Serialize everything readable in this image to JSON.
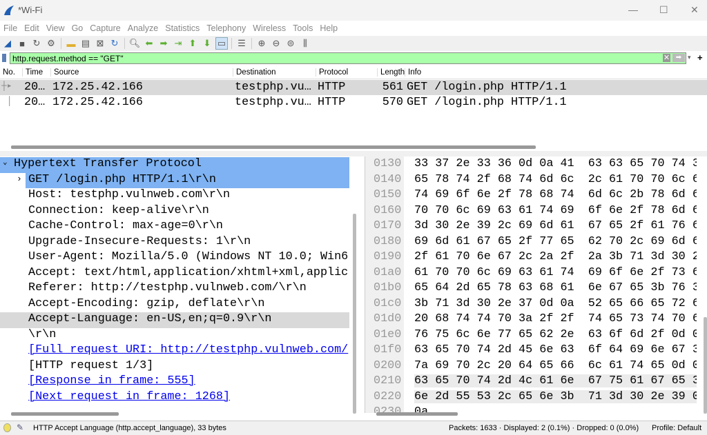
{
  "window": {
    "title": "*Wi-Fi"
  },
  "menu": [
    "File",
    "Edit",
    "View",
    "Go",
    "Capture",
    "Analyze",
    "Statistics",
    "Telephony",
    "Wireless",
    "Tools",
    "Help"
  ],
  "filter": {
    "value": "http.request.method == \"GET\""
  },
  "columns": [
    "No.",
    "Time",
    "Source",
    "Destination",
    "Protocol",
    "Length",
    "Info"
  ],
  "packets": [
    {
      "time": "20…",
      "source": "172.25.42.166",
      "destination": "testphp.vu…",
      "protocol": "HTTP",
      "length": "561",
      "info": "GET /login.php HTTP/1.1"
    },
    {
      "time": "20…",
      "source": "172.25.42.166",
      "destination": "testphp.vu…",
      "protocol": "HTTP",
      "length": "570",
      "info": "GET /login.php HTTP/1.1"
    }
  ],
  "details": {
    "root": "Hypertext Transfer Protocol",
    "lines": [
      "GET /login.php HTTP/1.1\\r\\n",
      "Host: testphp.vulnweb.com\\r\\n",
      "Connection: keep-alive\\r\\n",
      "Cache-Control: max-age=0\\r\\n",
      "Upgrade-Insecure-Requests: 1\\r\\n",
      "User-Agent: Mozilla/5.0 (Windows NT 10.0; Win6",
      "Accept: text/html,application/xhtml+xml,applic",
      "Referer: http://testphp.vulnweb.com/\\r\\n",
      "Accept-Encoding: gzip, deflate\\r\\n",
      "Accept-Language: en-US,en;q=0.9\\r\\n",
      "\\r\\n",
      "[Full request URI: http://testphp.vulnweb.com/",
      "[HTTP request 1/3]",
      "[Response in frame: 555]",
      "[Next request in frame: 1268]"
    ]
  },
  "hex": [
    {
      "off": "0130",
      "bytes": "33 37 2e 33 36 0d 0a 41  63 63 65 70 74 3"
    },
    {
      "off": "0140",
      "bytes": "65 78 74 2f 68 74 6d 6c  2c 61 70 70 6c 6"
    },
    {
      "off": "0150",
      "bytes": "74 69 6f 6e 2f 78 68 74  6d 6c 2b 78 6d 6"
    },
    {
      "off": "0160",
      "bytes": "70 70 6c 69 63 61 74 69  6f 6e 2f 78 6d 6"
    },
    {
      "off": "0170",
      "bytes": "3d 30 2e 39 2c 69 6d 61  67 65 2f 61 76 6"
    },
    {
      "off": "0180",
      "bytes": "69 6d 61 67 65 2f 77 65  62 70 2c 69 6d 6"
    },
    {
      "off": "0190",
      "bytes": "2f 61 70 6e 67 2c 2a 2f  2a 3b 71 3d 30 2"
    },
    {
      "off": "01a0",
      "bytes": "61 70 70 6c 69 63 61 74  69 6f 6e 2f 73 6"
    },
    {
      "off": "01b0",
      "bytes": "65 64 2d 65 78 63 68 61  6e 67 65 3b 76 3"
    },
    {
      "off": "01c0",
      "bytes": "3b 71 3d 30 2e 37 0d 0a  52 65 66 65 72 6"
    },
    {
      "off": "01d0",
      "bytes": "20 68 74 74 70 3a 2f 2f  74 65 73 74 70 6"
    },
    {
      "off": "01e0",
      "bytes": "76 75 6c 6e 77 65 62 2e  63 6f 6d 2f 0d 0"
    },
    {
      "off": "01f0",
      "bytes": "63 65 70 74 2d 45 6e 63  6f 64 69 6e 67 3"
    },
    {
      "off": "0200",
      "bytes": "7a 69 70 2c 20 64 65 66  6c 61 74 65 0d 0"
    },
    {
      "off": "0210",
      "bytes": "63 65 70 74 2d 4c 61 6e  67 75 61 67 65 3"
    },
    {
      "off": "0220",
      "bytes": "6e 2d 55 53 2c 65 6e 3b  71 3d 30 2e 39 0"
    },
    {
      "off": "0230",
      "bytes": "0a"
    }
  ],
  "status": {
    "field": "HTTP Accept Language (http.accept_language), 33 bytes",
    "packets": "Packets: 1633 · Displayed: 2 (0.1%) · Dropped: 0 (0.0%)",
    "profile": "Profile: Default"
  }
}
